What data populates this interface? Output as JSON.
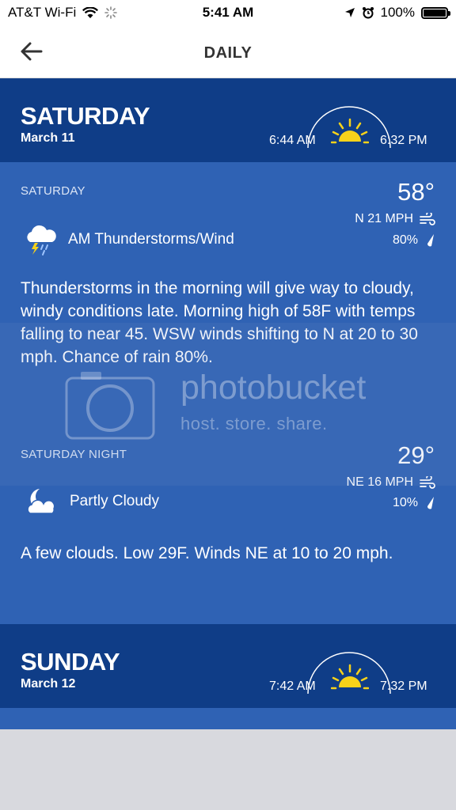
{
  "status_bar": {
    "carrier": "AT&T Wi-Fi",
    "time": "5:41 AM",
    "battery": "100%"
  },
  "nav": {
    "title": "DAILY"
  },
  "days": [
    {
      "name": "SATURDAY",
      "date": "March 11",
      "sunrise": "6:44 AM",
      "sunset": "6:32 PM",
      "periods": [
        {
          "label": "SATURDAY",
          "temp": "58°",
          "wind": "N 21 MPH",
          "precip": "80%",
          "condition": "AM Thunderstorms/Wind",
          "icon": "thunderstorm-icon",
          "description": "Thunderstorms in the morning will give way to cloudy, windy conditions late. Morning high of 58F with temps falling to near 45. WSW winds shifting to N at 20 to 30 mph. Chance of rain 80%."
        },
        {
          "label": "SATURDAY NIGHT",
          "temp": "29°",
          "wind": "NE 16 MPH",
          "precip": "10%",
          "condition": "Partly Cloudy",
          "icon": "partly-cloudy-night-icon",
          "description": "A few clouds. Low 29F. Winds NE at 10 to 20 mph."
        }
      ]
    },
    {
      "name": "SUNDAY",
      "date": "March 12",
      "sunrise": "7:42 AM",
      "sunset": "7:32 PM"
    }
  ],
  "watermark": {
    "main": "photobucket",
    "sub": "host. store. share."
  },
  "colors": {
    "header_bg": "#0f3d87",
    "detail_bg": "#2f62b4",
    "sun": "#f7d21a"
  }
}
